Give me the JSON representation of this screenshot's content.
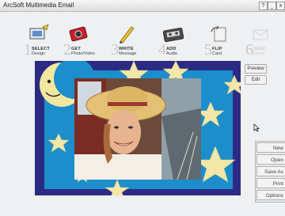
{
  "window": {
    "title": "ArcSoft Multimedia Email",
    "help": "?",
    "minimize": "_",
    "close": "x"
  },
  "toolbar": {
    "steps": [
      {
        "num": "1",
        "line1": "SELECT",
        "line2": "Design",
        "icon": "design-icon"
      },
      {
        "num": "2",
        "line1": "GET",
        "line2": "Photo/Video",
        "icon": "camera-icon"
      },
      {
        "num": "3",
        "line1": "WRITE",
        "line2": "Message",
        "icon": "pencil-icon"
      },
      {
        "num": "4",
        "line1": "ADD",
        "line2": "Audio",
        "icon": "cassette-icon"
      },
      {
        "num": "5",
        "line1": "FLIP",
        "line2": "Card",
        "icon": "flip-card-icon"
      },
      {
        "num": "6",
        "line1": "SEND",
        "line2": "Email",
        "icon": "send-icon"
      }
    ]
  },
  "side": {
    "preview": "Preview",
    "edit": "Edit"
  },
  "actions": {
    "new": "New",
    "open": "Open",
    "save_as": "Save As",
    "print": "Print",
    "options": "Options"
  },
  "colors": {
    "frame": "#2b2b84",
    "sky": "#1c8ecb",
    "star": "#f2e6a8",
    "moon": "#f3e7a0"
  }
}
